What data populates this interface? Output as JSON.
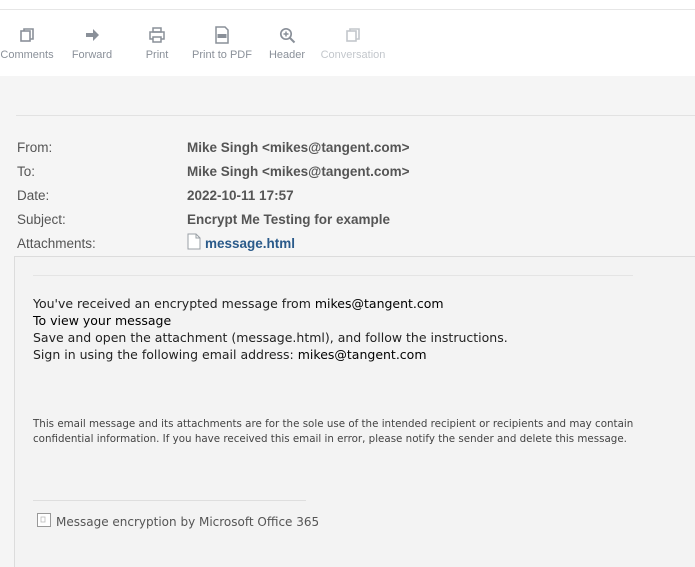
{
  "toolbar": {
    "buttons": [
      {
        "label": "Comments",
        "icon": "comments-icon"
      },
      {
        "label": "Forward",
        "icon": "forward-arrow-icon"
      },
      {
        "label": "Print",
        "icon": "printer-icon"
      },
      {
        "label": "Print to PDF",
        "icon": "pdf-icon"
      },
      {
        "label": "Header",
        "icon": "zoom-in-icon"
      },
      {
        "label": "Conversation",
        "icon": "conversation-icon"
      }
    ]
  },
  "header": {
    "from_label": "From:",
    "from_value": "Mike Singh <mikes@tangent.com>",
    "to_label": "To:",
    "to_value": "Mike Singh <mikes@tangent.com>",
    "date_label": "Date:",
    "date_value": "2022-10-11 17:57",
    "subject_label": "Subject:",
    "subject_value": "Encrypt Me Testing for example",
    "attachments_label": "Attachments:",
    "attachment_name": "message.html"
  },
  "message": {
    "line1_prefix": "You've received an encrypted message from ",
    "line1_sender": "mikes@tangent.com",
    "line2": "To view your message",
    "line3": "Save and open the attachment (message.html), and follow the instructions.",
    "line4_prefix": "Sign in using the following email address: ",
    "line4_email": "mikes@tangent.com",
    "disclaimer": "This email message and its attachments are for the sole use of the intended recipient or recipients and may contain confidential information. If you have received this email in error, please notify the sender and delete this message.",
    "footer": "Message encryption by Microsoft Office 365"
  },
  "colors": {
    "accent_link": "#2a5a8a",
    "toolbar_text": "#8a9099",
    "disabled_text": "#c3c7cc"
  }
}
